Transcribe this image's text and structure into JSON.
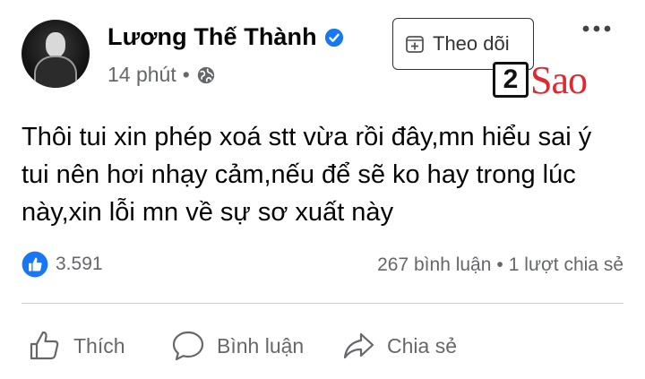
{
  "post": {
    "author": "Lương Thế Thành",
    "time": "14 phút",
    "separator": "•",
    "follow_label": "Theo dõi",
    "text": "Thôi tui xin phép xoá stt vừa rồi đây,mn hiểu sai ý tui nên hơi nhạy cảm,nếu để sẽ ko hay trong lúc này,xin lỗi mn về sự sơ xuất này"
  },
  "watermark": {
    "digit": "2",
    "text": "Sao",
    "color": "#e0282f"
  },
  "stats": {
    "likes": "3.591",
    "comments": "267 bình luận",
    "dot": "•",
    "shares": "1 lượt chia sẻ"
  },
  "actions": {
    "like": "Thích",
    "comment": "Bình luận",
    "share": "Chia sẻ"
  },
  "colors": {
    "accent": "#1877f2",
    "secondary_text": "#65676b",
    "divider": "#ced0d4"
  },
  "icons": [
    "verified-icon",
    "globe-icon",
    "follow-icon",
    "more-icon",
    "like-reaction-icon",
    "thumbs-up-icon",
    "comment-icon",
    "share-icon"
  ]
}
